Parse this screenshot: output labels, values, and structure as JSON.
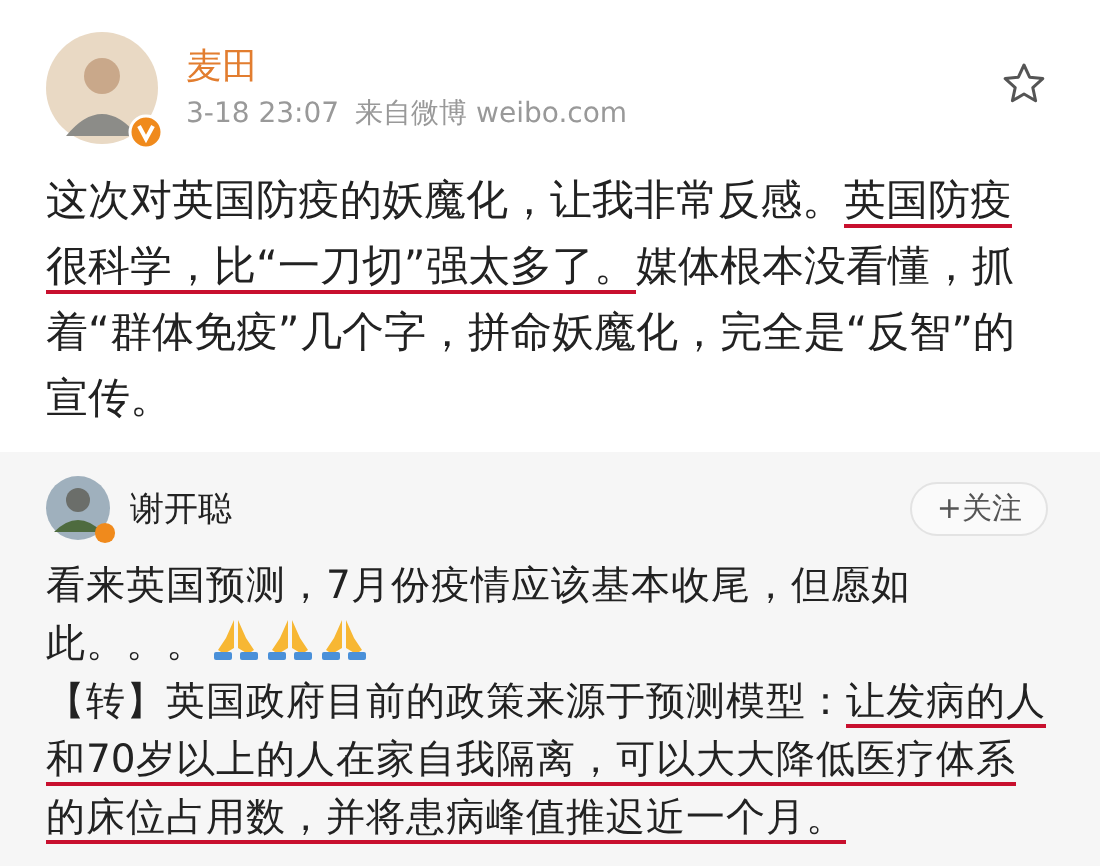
{
  "post": {
    "author": "麦田",
    "verified": true,
    "time": "3-18 23:07",
    "source": "来自微博 weibo.com",
    "starred": false,
    "segments": [
      {
        "text": "这次对英国防疫的妖魔化，让我非常反感。",
        "marked": false
      },
      {
        "text": "英国防疫很科学，比“一刀切”强太多了。",
        "marked": true
      },
      {
        "text": "媒体根本没看懂，抓着“群体免疫”几个字，拼命妖魔化，完全是“反智”的宣传。",
        "marked": false
      }
    ]
  },
  "comment": {
    "author": "谢开聪",
    "verified": true,
    "follow_button": "+关注",
    "paragraphs": [
      {
        "segments": [
          {
            "text": "看来英国预测，7月份疫情应该基本收尾，但愿如此。。。",
            "marked": false
          }
        ],
        "emoji": [
          {
            "kind": "praying-hands"
          },
          {
            "kind": "praying-hands"
          },
          {
            "kind": "praying-hands"
          }
        ]
      },
      {
        "segments": [
          {
            "text": "【转】英国政府目前的政策来源于预测模型：",
            "marked": false
          },
          {
            "text": "让发病的人和70岁以上的人在家自我隔离，可以大大降低医疗体系的床位占用数，并将患病峰值推迟近一个月。",
            "marked": true
          }
        ]
      }
    ]
  }
}
